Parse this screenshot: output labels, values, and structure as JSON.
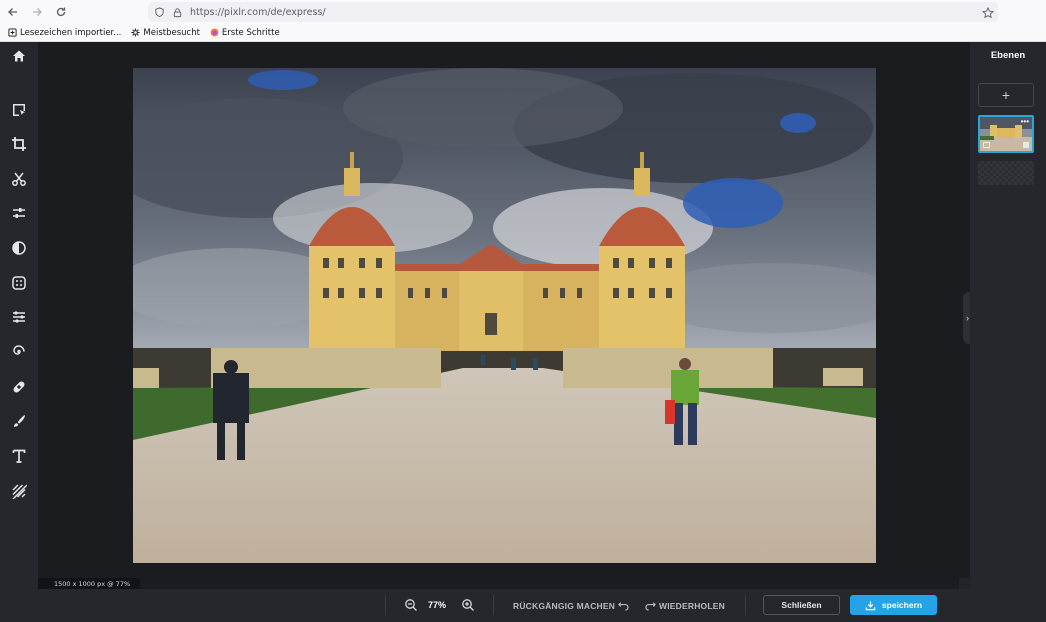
{
  "browser": {
    "url": "https://pixlr.com/de/express/",
    "bookmarks": [
      {
        "label": "Lesezeichen importier...",
        "icon": "import-icon"
      },
      {
        "label": "Meistbesucht",
        "icon": "gear-icon"
      },
      {
        "label": "Erste Schritte",
        "icon": "firefox-icon"
      }
    ]
  },
  "toolbar": {
    "tools": [
      "home-icon",
      "arrange-icon",
      "crop-icon",
      "cutout-icon",
      "adjust-icon",
      "filter-icon",
      "effect-icon",
      "retouch-icon",
      "liquify-icon",
      "heal-icon",
      "draw-icon",
      "text-icon",
      "pattern-icon"
    ]
  },
  "canvas": {
    "info": "1500 x 1000 px @ 77%"
  },
  "layers_panel": {
    "title": "Ebenen",
    "add_label": "+"
  },
  "bottom": {
    "zoom": "77%",
    "undo_label": "RÜCKGÄNGIG MACHEN",
    "redo_label": "WIEDERHOLEN",
    "close_label": "Schließen",
    "save_label": "speichern"
  },
  "colors": {
    "accent": "#24a3e6",
    "panel": "#26272c",
    "workspace": "#1b1c20"
  }
}
